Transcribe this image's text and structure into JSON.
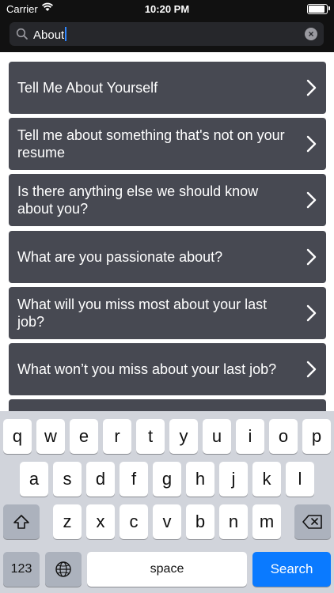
{
  "status_bar": {
    "carrier": "Carrier",
    "time": "10:20 PM",
    "battery_level": 0.9
  },
  "search": {
    "value": "About",
    "search_icon": "search-icon",
    "clear_icon": "clear-icon"
  },
  "results": [
    {
      "label": "Tell Me About Yourself"
    },
    {
      "label": "Tell me about something that's not on your resume"
    },
    {
      "label": "Is there anything else we should know about you?"
    },
    {
      "label": "What are you passionate about?"
    },
    {
      "label": "What will you miss most about your last job?"
    },
    {
      "label": "What won’t you miss about your last job?"
    },
    {
      "label": ""
    }
  ],
  "keyboard": {
    "row1": [
      "q",
      "w",
      "e",
      "r",
      "t",
      "y",
      "u",
      "i",
      "o",
      "p"
    ],
    "row2": [
      "a",
      "s",
      "d",
      "f",
      "g",
      "h",
      "j",
      "k",
      "l"
    ],
    "row3": [
      "z",
      "x",
      "c",
      "v",
      "b",
      "n",
      "m"
    ],
    "numbers_label": "123",
    "space_label": "space",
    "search_label": "Search",
    "shift_icon": "shift-icon",
    "delete_icon": "delete-icon",
    "globe_icon": "globe-icon"
  },
  "colors": {
    "header": "#111111",
    "row_background": "#474952",
    "keyboard_background": "#d1d4db",
    "search_key": "#0a7aff"
  }
}
